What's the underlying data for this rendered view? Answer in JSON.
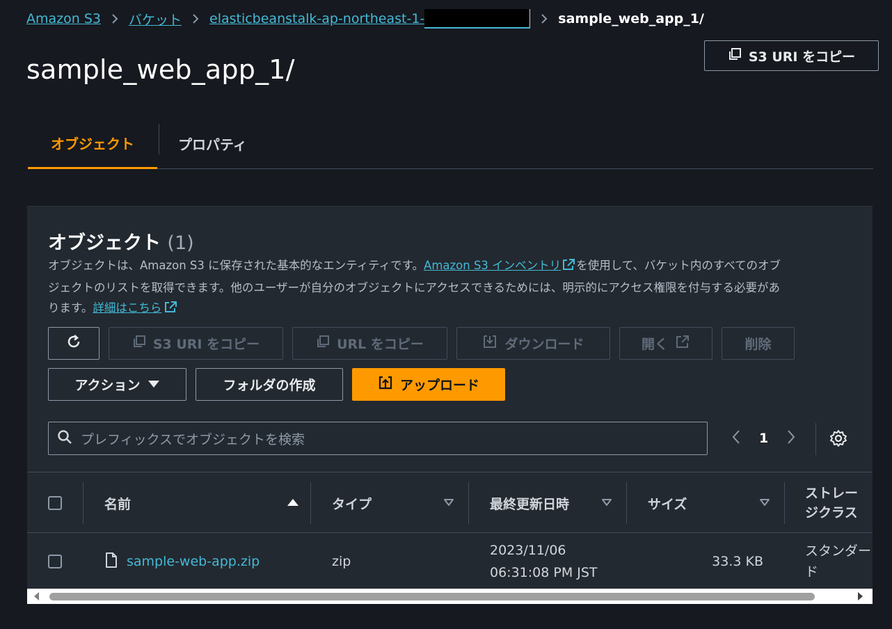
{
  "breadcrumb": {
    "root": "Amazon S3",
    "buckets": "バケット",
    "bucket_prefix": "elasticbeanstalk-ap-northeast-1-",
    "current": "sample_web_app_1/"
  },
  "page": {
    "title": "sample_web_app_1/",
    "copy_uri_label": "S3 URI をコピー"
  },
  "tabs": [
    {
      "label": "オブジェクト",
      "active": true
    },
    {
      "label": "プロパティ",
      "active": false
    }
  ],
  "objects_panel": {
    "title": "オブジェクト",
    "count": "(1)",
    "desc_part1": "オブジェクトは、Amazon S3 に保存された基本的なエンティティです。",
    "desc_link1": "Amazon S3 インベントリ",
    "desc_part2": "を使用して、バケット内のすべてのオブ",
    "desc_part3": "ジェクトのリストを取得できます。他のユーザーが自分のオブジェクトにアクセスできるためには、明示的にアクセス権限を付与する必要があ",
    "desc_part4": "ります。",
    "desc_link2": "詳細はこちら"
  },
  "toolbar": {
    "copy_s3_uri": "S3 URI をコピー",
    "copy_url": "URL をコピー",
    "download": "ダウンロード",
    "open": "開く",
    "delete": "削除",
    "actions": "アクション",
    "create_folder": "フォルダの作成",
    "upload": "アップロード"
  },
  "search": {
    "placeholder": "プレフィックスでオブジェクトを検索"
  },
  "pagination": {
    "current_page": "1"
  },
  "table": {
    "columns": [
      "名前",
      "タイプ",
      "最終更新日時",
      "サイズ",
      "ストレー",
      "ジクラス"
    ],
    "rows": [
      {
        "name": "sample-web-app.zip",
        "type": "zip",
        "modified_date": "2023/11/06",
        "modified_time": "06:31:08 PM JST",
        "size": "33.3 KB",
        "storage_class_1": "スタンダー",
        "storage_class_2": "ド"
      }
    ]
  },
  "colors": {
    "background": "#16191f",
    "panel": "#232930",
    "link": "#44b9d6",
    "accent": "#ff9900"
  }
}
